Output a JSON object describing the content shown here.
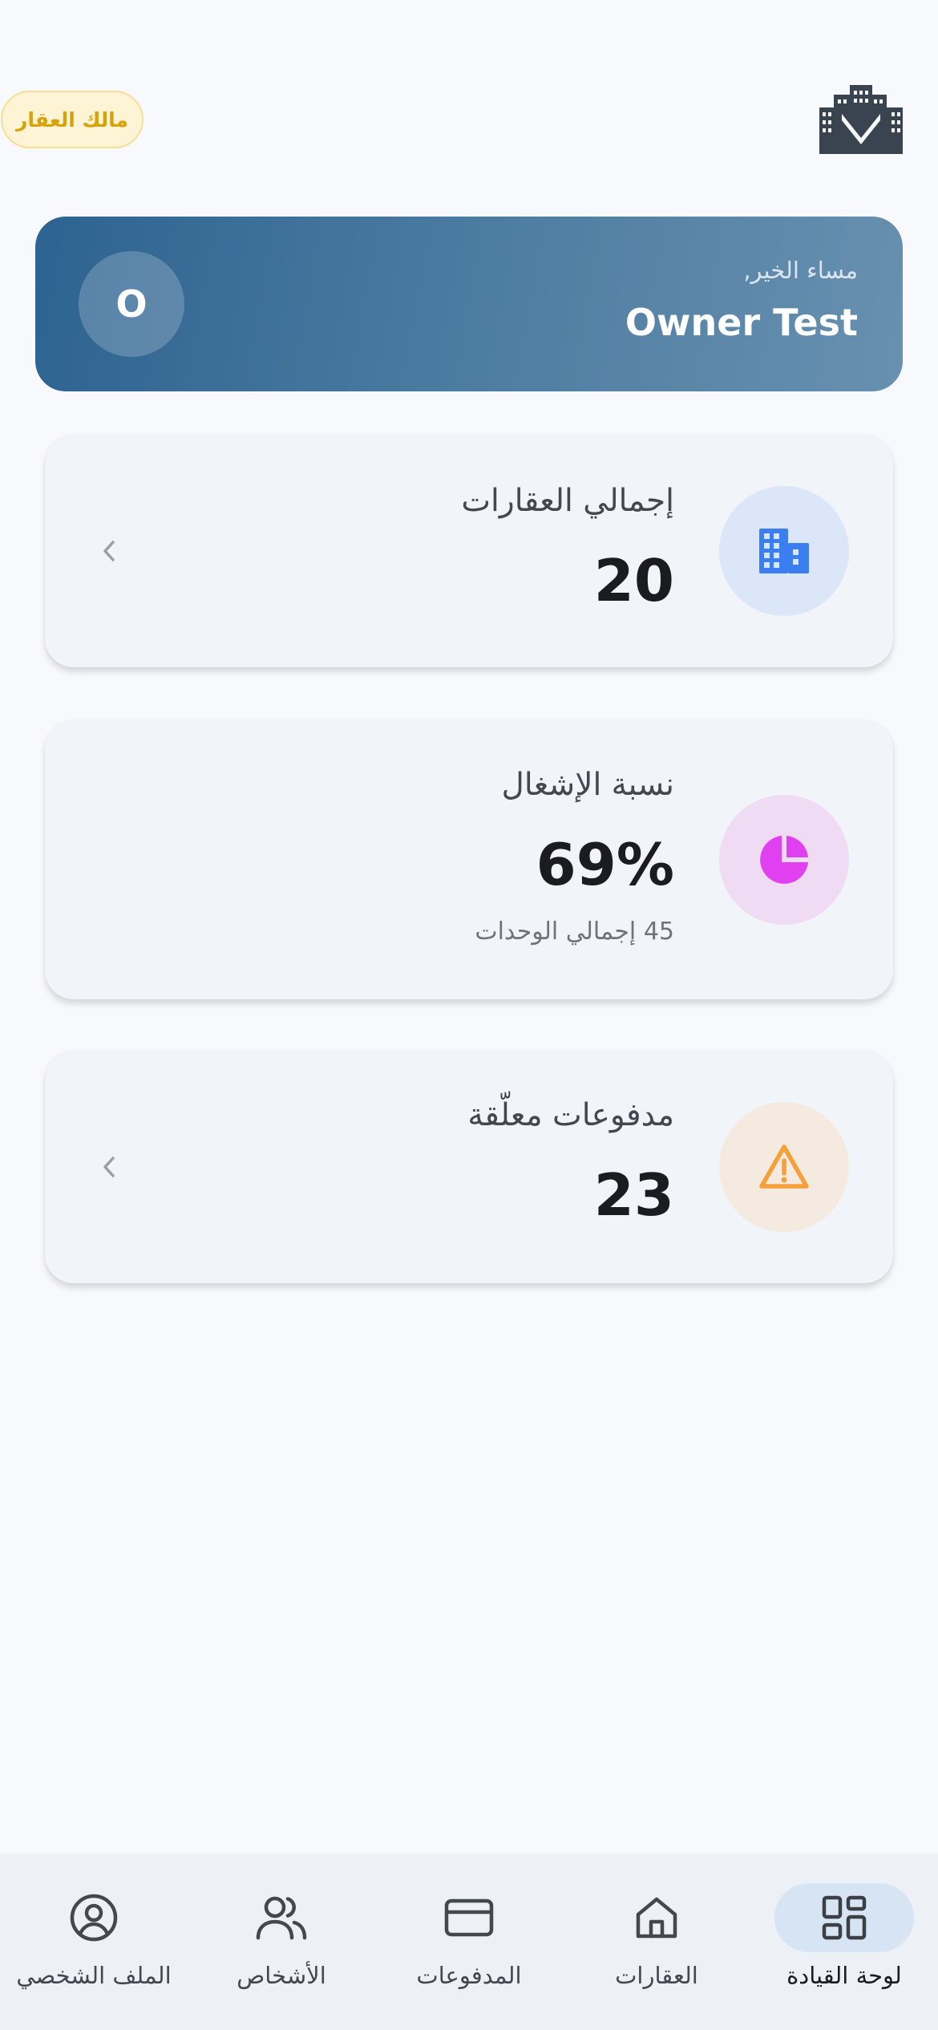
{
  "header": {
    "role_badge": "مالك العقار",
    "logo_icon": "building-logo-icon"
  },
  "welcome": {
    "avatar_initial": "O",
    "greeting": "مساء الخير,",
    "user_name": "Owner Test"
  },
  "cards": [
    {
      "title": "إجمالي العقارات",
      "value": "20",
      "icon": "building-icon",
      "icon_color": "#3b7ef0",
      "icon_bg": "#dbe6f8"
    },
    {
      "title": "نسبة الإشغال",
      "value": "69%",
      "subtitle": "45 إجمالي الوحدات",
      "icon": "pie-chart-icon",
      "icon_color": "#e040f0",
      "icon_bg": "#f0dbf5"
    },
    {
      "title": "مدفوعات معلّقة",
      "value": "23",
      "icon": "warning-icon",
      "icon_color": "#f5a03a",
      "icon_bg": "#f5eadf"
    }
  ],
  "nav": [
    {
      "label": "لوحة القيادة",
      "icon": "dashboard-icon",
      "active": true
    },
    {
      "label": "العقارات",
      "icon": "home-icon",
      "active": false
    },
    {
      "label": "المدفوعات",
      "icon": "credit-card-icon",
      "active": false
    },
    {
      "label": "الأشخاص",
      "icon": "people-icon",
      "active": false
    },
    {
      "label": "الملف الشخصي",
      "icon": "profile-icon",
      "active": false
    }
  ],
  "colors": {
    "background": "#f7f9fd",
    "welcome_gradient_start": "#2d6391",
    "welcome_gradient_end": "#6890b0",
    "badge_bg": "#fdf4d6",
    "badge_text": "#d6a30a",
    "nav_active_pill": "#d7e4f4"
  }
}
